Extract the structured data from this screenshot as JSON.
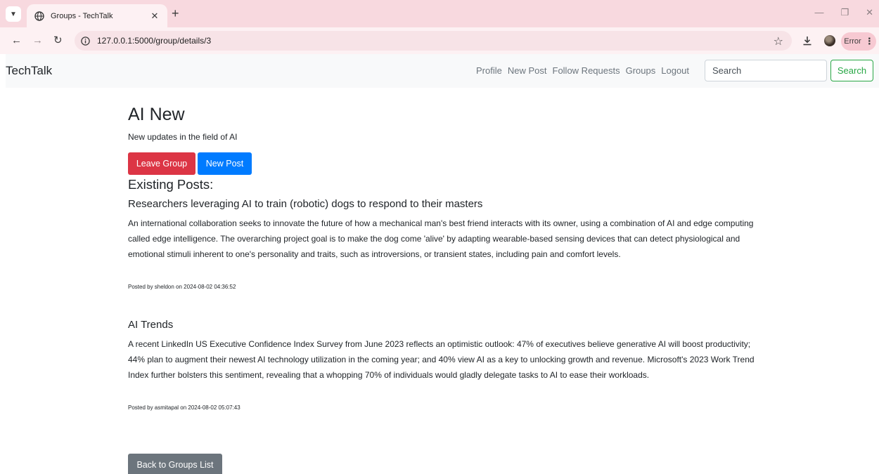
{
  "browser": {
    "tab_title": "Groups - TechTalk",
    "url": "127.0.0.1:5000/group/details/3",
    "error_label": "Error"
  },
  "navbar": {
    "brand": "TechTalk",
    "links": [
      "Profile",
      "New Post",
      "Follow Requests",
      "Groups",
      "Logout"
    ],
    "search_placeholder": "Search",
    "search_button": "Search"
  },
  "group": {
    "title": "AI New",
    "description": "New updates in the field of AI",
    "leave_button": "Leave Group",
    "new_post_button": "New Post",
    "existing_posts_heading": "Existing Posts:",
    "back_button": "Back to Groups List"
  },
  "posts": [
    {
      "title": "Researchers leveraging AI to train (robotic) dogs to respond to their masters",
      "body": "An international collaboration seeks to innovate the future of how a mechanical man's best friend interacts with its owner, using a combination of AI and edge computing called edge intelligence. The overarching project goal is to make the dog come 'alive' by adapting wearable-based sensing devices that can detect physiological and emotional stimuli inherent to one's personality and traits, such as introversions, or transient states, including pain and comfort levels.",
      "meta": "Posted by sheldon on 2024-08-02 04:36:52"
    },
    {
      "title": "AI Trends",
      "body": "A recent LinkedIn US Executive Confidence Index Survey from June 2023 reflects an optimistic outlook: 47% of executives believe generative AI will boost productivity; 44% plan to augment their newest AI technology utilization in the coming year; and 40% view AI as a key to unlocking growth and revenue. Microsoft's 2023 Work Trend Index further bolsters this sentiment, revealing that a whopping 70% of individuals would gladly delegate tasks to AI to ease their workloads.",
      "meta": "Posted by asmitapal on 2024-08-02 05:07:43"
    }
  ]
}
